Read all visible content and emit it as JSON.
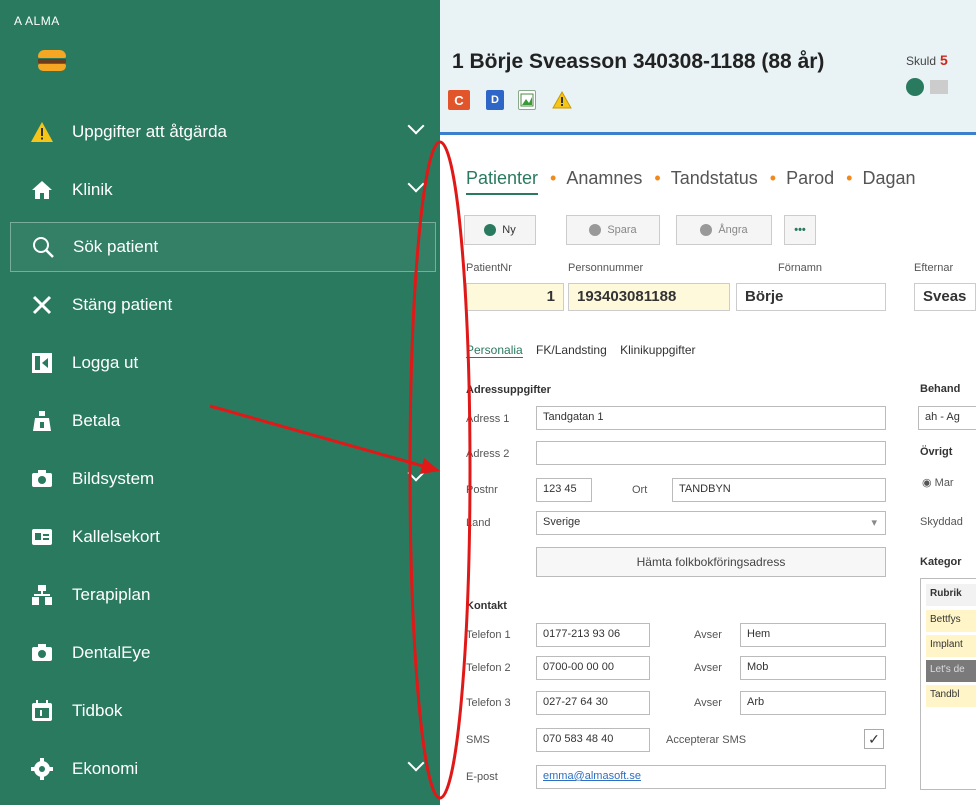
{
  "app": {
    "title": "A  ALMA"
  },
  "sidebar": {
    "items": [
      {
        "label": "Uppgifter att åtgärda",
        "icon": "warning-icon",
        "chevron": true
      },
      {
        "label": "Klinik",
        "icon": "home-icon",
        "chevron": true
      },
      {
        "label": "Sök patient",
        "icon": "search-icon",
        "active": true
      },
      {
        "label": "Stäng patient",
        "icon": "close-icon"
      },
      {
        "label": "Logga ut",
        "icon": "logout-icon"
      },
      {
        "label": "Betala",
        "icon": "pay-icon"
      },
      {
        "label": "Bildsystem",
        "icon": "camera-icon",
        "chevron": true
      },
      {
        "label": "Kallelsekort",
        "icon": "card-icon"
      },
      {
        "label": "Terapiplan",
        "icon": "tree-icon"
      },
      {
        "label": "DentalEye",
        "icon": "camera-icon"
      },
      {
        "label": "Tidbok",
        "icon": "calendar-icon"
      },
      {
        "label": "Ekonomi",
        "icon": "gear-icon",
        "chevron": true
      }
    ]
  },
  "header": {
    "patient": "1 Börje Sveasson 340308-1188 (88 år)",
    "skuld_label": "Skuld",
    "skuld_value": "5",
    "badges": [
      "C",
      "D"
    ]
  },
  "tabs": [
    "Patienter",
    "Anamnes",
    "Tandstatus",
    "Parod",
    "Dagan"
  ],
  "toolbar": {
    "new": "Ny",
    "save": "Spara",
    "undo": "Ångra",
    "more": "•••"
  },
  "patient_fields": {
    "labels": {
      "nr": "PatientNr",
      "pnr": "Personnummer",
      "fornamn": "Förnamn",
      "efternamn": "Efternar"
    },
    "values": {
      "nr": "1",
      "pnr": "193403081188",
      "fornamn": "Börje",
      "efternamn": "Sveas"
    }
  },
  "subtabs": [
    "Personalia",
    "FK/Landsting",
    "Klinikuppgifter"
  ],
  "address": {
    "section": "Adressuppgifter",
    "adress1_label": "Adress 1",
    "adress1": "Tandgatan 1",
    "adress2_label": "Adress 2",
    "adress2": "",
    "postnr_label": "Postnr",
    "postnr": "123 45",
    "ort_label": "Ort",
    "ort": "TANDBYN",
    "land_label": "Land",
    "land": "Sverige",
    "fetch_button": "Hämta folkbokföringsadress"
  },
  "contact": {
    "section": "Kontakt",
    "phones": [
      {
        "label": "Telefon 1",
        "value": "0177-213 93 06",
        "avser": "Hem"
      },
      {
        "label": "Telefon 2",
        "value": "0700-00 00 00",
        "avser": "Mob"
      },
      {
        "label": "Telefon 3",
        "value": "027-27 64 30",
        "avser": "Arb"
      }
    ],
    "avser_label": "Avser",
    "sms_label": "SMS",
    "sms": "070 583 48 40",
    "accept_sms": "Accepterar SMS",
    "email_label": "E-post",
    "email": "emma@almasoft.se"
  },
  "right": {
    "behand_label": "Behand",
    "behand_value": "ah - Ag",
    "ovrigt_label": "Övrigt",
    "radio_label": "Mar",
    "skyddad_label": "Skyddad",
    "kategori_label": "Kategor",
    "kategori_header": "Rubrik",
    "kategori_rows": [
      "Bettfys",
      "Implant",
      "Let's de",
      "Tandbl"
    ]
  }
}
